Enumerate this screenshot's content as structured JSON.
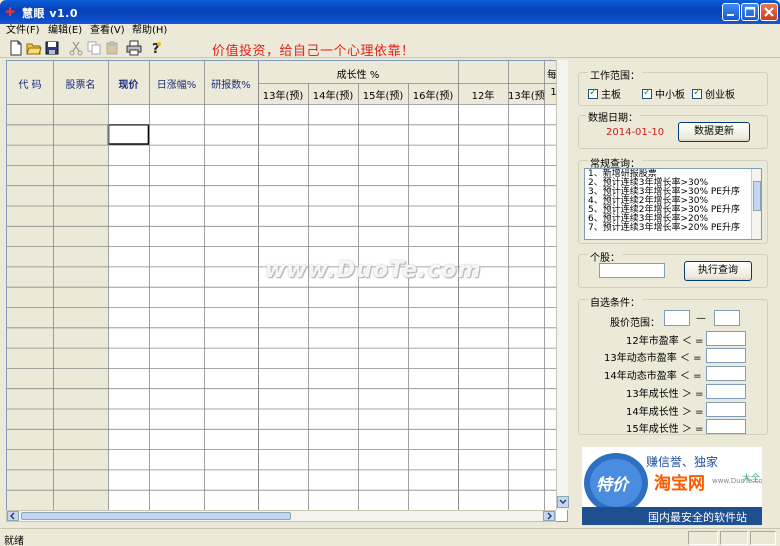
{
  "window": {
    "title": "慧眼 v1.0",
    "app_icon": "app-logo-icon"
  },
  "menu": [
    {
      "label": "文件(F)"
    },
    {
      "label": "编辑(E)"
    },
    {
      "label": "查看(V)"
    },
    {
      "label": "帮助(H)"
    }
  ],
  "toolbar": {
    "buttons": [
      "new-file-icon",
      "open-folder-icon",
      "save-icon",
      "cut-icon",
      "copy-icon",
      "paste-icon",
      "print-icon",
      "help-icon"
    ],
    "slogan": "价值投资，给自己一个心理依靠！"
  },
  "grid": {
    "group_header": "成长性 %",
    "group_header_right": "每",
    "columns": [
      "代 码",
      "股票名",
      "现价",
      "日涨幅%",
      "研报数%"
    ],
    "subcolumns": [
      "13年(预)",
      "14年(预)",
      "15年(预)",
      "16年(预)",
      "12年",
      "13年(预)",
      "1"
    ],
    "row_count": 19
  },
  "panel": {
    "scope_title": "工作范围：",
    "scope_options": [
      "主板",
      "中小板",
      "创业板"
    ],
    "date_title": "数据日期：",
    "date_value": "2014-01-10",
    "update_button": "数据更新",
    "query_title": "常规查询：",
    "queries": [
      "1、新增研报股票",
      "2、预计连续3年增长率>30%",
      "3、预计连续3年增长率>30% PE升序",
      "4、预计连续2年增长率>30%",
      "5、预计连续2年增长率>30% PE升序",
      "6、预计连续3年增长率>20%",
      "7、预计连续3年增长率>20% PE升序"
    ],
    "stock_title": "个股：",
    "exec_button": "执行查询",
    "custom_title": "自选条件：",
    "price_range_label": "股价范围：",
    "range_dash": "—",
    "conditions": [
      "12年市盈率 ＜ =",
      "13年动态市盈率 ＜ =",
      "14年动态市盈率 ＜ =",
      "13年成长性 ＞ =",
      "14年成长性 ＞ =",
      "15年成长性 ＞ ="
    ]
  },
  "ad": {
    "badge": "特价",
    "line1": "赚信誉、独家",
    "brand": "淘宝网",
    "site": "www.DuoTe.com",
    "tag": "大全",
    "footer": "国内最安全的软件站"
  },
  "watermark": "www.DuoTe.com",
  "status": {
    "text": "就绪"
  },
  "colors": {
    "slogan": "#e2231a",
    "date": "#d21d1d",
    "titlebar": "#0a5fd8"
  }
}
